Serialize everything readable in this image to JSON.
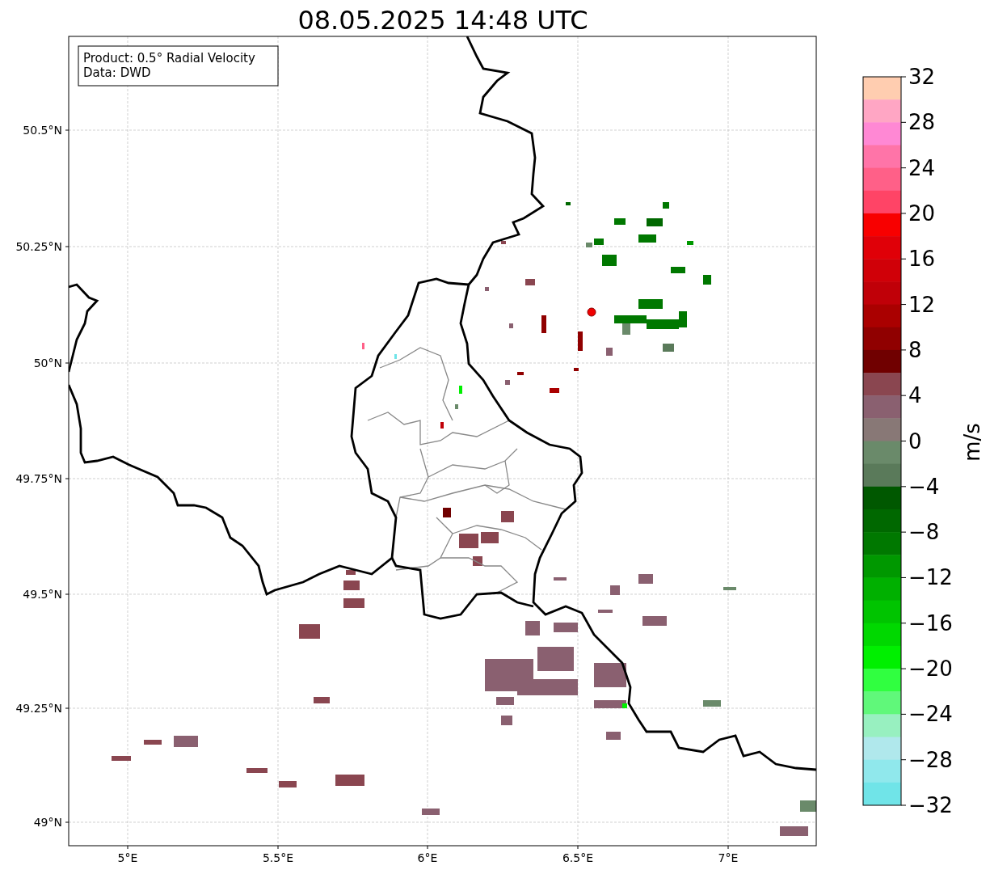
{
  "title": "08.05.2025 14:48 UTC",
  "legend": {
    "lines": [
      "Product: 0.5° Radial Velocity",
      "Data: DWD"
    ]
  },
  "map": {
    "lat_ticks": [
      "50.5°N",
      "50.25°N",
      "50°N",
      "49.75°N",
      "49.5°N",
      "49.25°N",
      "49°N"
    ],
    "lon_ticks": [
      "5°E",
      "5.5°E",
      "6°E",
      "6.5°E",
      "7°E"
    ]
  },
  "colorbar": {
    "ticks": [
      "32",
      "28",
      "24",
      "20",
      "16",
      "12",
      "8",
      "4",
      "0",
      "−4",
      "−8",
      "−12",
      "−16",
      "−20",
      "−24",
      "−28",
      "−32"
    ],
    "label": "m/s"
  }
}
